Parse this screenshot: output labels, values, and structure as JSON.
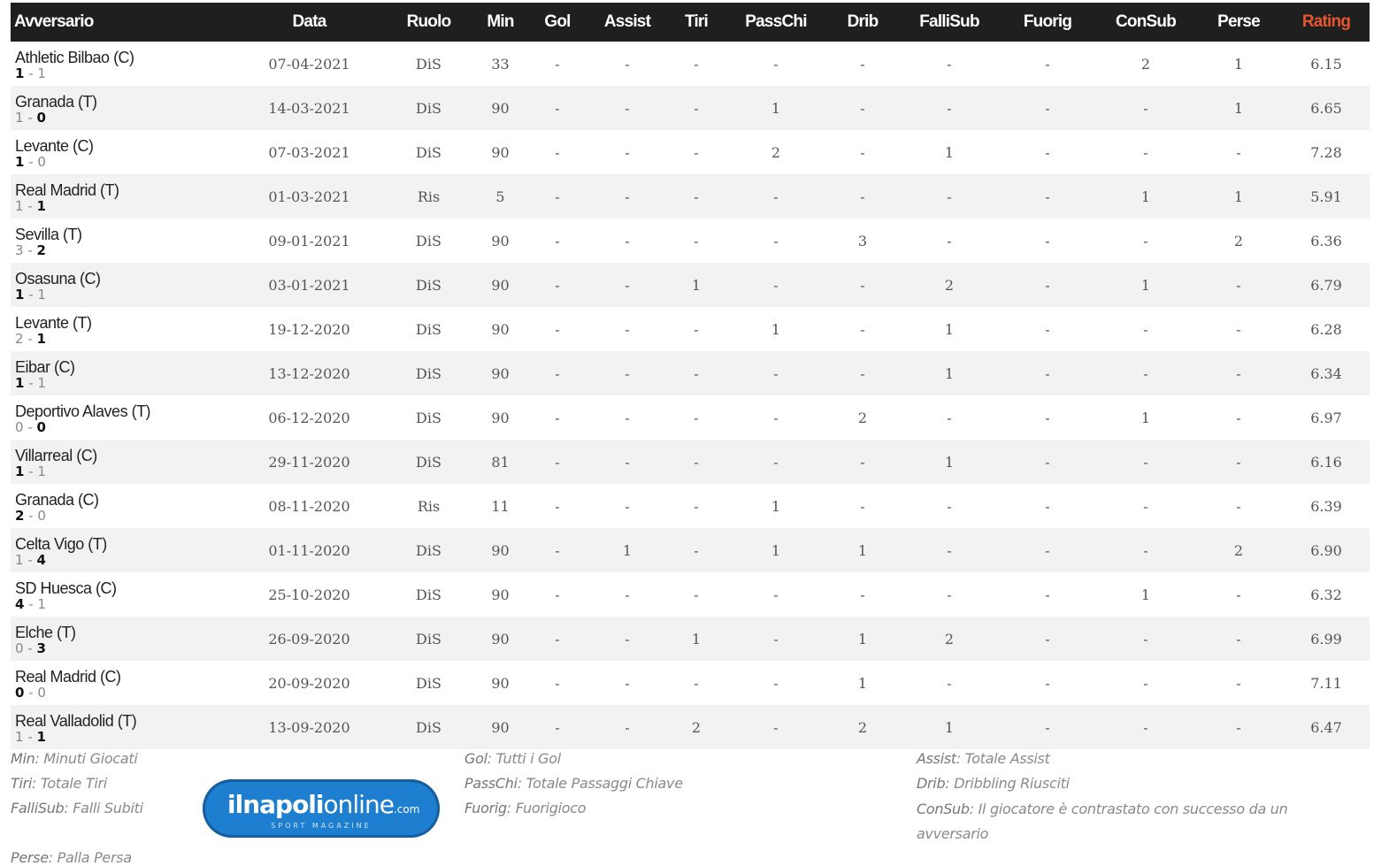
{
  "table": {
    "headers": [
      "Avversario",
      "Data",
      "Ruolo",
      "Min",
      "Gol",
      "Assist",
      "Tiri",
      "PassChi",
      "Drib",
      "FalliSub",
      "Fuorig",
      "ConSub",
      "Perse",
      "Rating"
    ],
    "rows": [
      {
        "opp": "Athletic Bilbao (C)",
        "s1": "1",
        "s2": "1",
        "bold": "left",
        "cells": [
          "07-04-2021",
          "DiS",
          "33",
          "-",
          "-",
          "-",
          "-",
          "-",
          "-",
          "-",
          "2",
          "1",
          "6.15"
        ]
      },
      {
        "opp": "Granada (T)",
        "s1": "1",
        "s2": "0",
        "bold": "right",
        "cells": [
          "14-03-2021",
          "DiS",
          "90",
          "-",
          "-",
          "-",
          "1",
          "-",
          "-",
          "-",
          "-",
          "1",
          "6.65"
        ]
      },
      {
        "opp": "Levante (C)",
        "s1": "1",
        "s2": "0",
        "bold": "left",
        "cells": [
          "07-03-2021",
          "DiS",
          "90",
          "-",
          "-",
          "-",
          "2",
          "-",
          "1",
          "-",
          "-",
          "-",
          "7.28"
        ]
      },
      {
        "opp": "Real Madrid (T)",
        "s1": "1",
        "s2": "1",
        "bold": "right",
        "cells": [
          "01-03-2021",
          "Ris",
          "5",
          "-",
          "-",
          "-",
          "-",
          "-",
          "-",
          "-",
          "1",
          "1",
          "5.91"
        ]
      },
      {
        "opp": "Sevilla (T)",
        "s1": "3",
        "s2": "2",
        "bold": "right",
        "cells": [
          "09-01-2021",
          "DiS",
          "90",
          "-",
          "-",
          "-",
          "-",
          "3",
          "-",
          "-",
          "-",
          "2",
          "6.36"
        ]
      },
      {
        "opp": "Osasuna (C)",
        "s1": "1",
        "s2": "1",
        "bold": "left",
        "cells": [
          "03-01-2021",
          "DiS",
          "90",
          "-",
          "-",
          "1",
          "-",
          "-",
          "2",
          "-",
          "1",
          "-",
          "6.79"
        ]
      },
      {
        "opp": "Levante (T)",
        "s1": "2",
        "s2": "1",
        "bold": "right",
        "cells": [
          "19-12-2020",
          "DiS",
          "90",
          "-",
          "-",
          "-",
          "1",
          "-",
          "1",
          "-",
          "-",
          "-",
          "6.28"
        ]
      },
      {
        "opp": "Eibar (C)",
        "s1": "1",
        "s2": "1",
        "bold": "left",
        "cells": [
          "13-12-2020",
          "DiS",
          "90",
          "-",
          "-",
          "-",
          "-",
          "-",
          "1",
          "-",
          "-",
          "-",
          "6.34"
        ]
      },
      {
        "opp": "Deportivo Alaves (T)",
        "s1": "0",
        "s2": "0",
        "bold": "right",
        "cells": [
          "06-12-2020",
          "DiS",
          "90",
          "-",
          "-",
          "-",
          "-",
          "2",
          "-",
          "-",
          "1",
          "-",
          "6.97"
        ]
      },
      {
        "opp": "Villarreal (C)",
        "s1": "1",
        "s2": "1",
        "bold": "left",
        "cells": [
          "29-11-2020",
          "DiS",
          "81",
          "-",
          "-",
          "-",
          "-",
          "-",
          "1",
          "-",
          "-",
          "-",
          "6.16"
        ]
      },
      {
        "opp": "Granada (C)",
        "s1": "2",
        "s2": "0",
        "bold": "left",
        "cells": [
          "08-11-2020",
          "Ris",
          "11",
          "-",
          "-",
          "-",
          "1",
          "-",
          "-",
          "-",
          "-",
          "-",
          "6.39"
        ]
      },
      {
        "opp": "Celta Vigo (T)",
        "s1": "1",
        "s2": "4",
        "bold": "right",
        "cells": [
          "01-11-2020",
          "DiS",
          "90",
          "-",
          "1",
          "-",
          "1",
          "1",
          "-",
          "-",
          "-",
          "2",
          "6.90"
        ]
      },
      {
        "opp": "SD Huesca (C)",
        "s1": "4",
        "s2": "1",
        "bold": "left",
        "cells": [
          "25-10-2020",
          "DiS",
          "90",
          "-",
          "-",
          "-",
          "-",
          "-",
          "-",
          "-",
          "1",
          "-",
          "6.32"
        ]
      },
      {
        "opp": "Elche (T)",
        "s1": "0",
        "s2": "3",
        "bold": "right",
        "cells": [
          "26-09-2020",
          "DiS",
          "90",
          "-",
          "-",
          "1",
          "-",
          "1",
          "2",
          "-",
          "-",
          "-",
          "6.99"
        ]
      },
      {
        "opp": "Real Madrid (C)",
        "s1": "0",
        "s2": "0",
        "bold": "left",
        "cells": [
          "20-09-2020",
          "DiS",
          "90",
          "-",
          "-",
          "-",
          "-",
          "1",
          "-",
          "-",
          "-",
          "-",
          "7.11"
        ]
      },
      {
        "opp": "Real Valladolid (T)",
        "s1": "1",
        "s2": "1",
        "bold": "right",
        "cells": [
          "13-09-2020",
          "DiS",
          "90",
          "-",
          "-",
          "2",
          "-",
          "2",
          "1",
          "-",
          "-",
          "-",
          "6.47"
        ]
      }
    ]
  },
  "legend": {
    "min_k": "Min",
    "min_v": ": Minuti Giocati",
    "tiri_k": "Tiri",
    "tiri_v": ": Totale Tiri",
    "fallisub_k": "FalliSub",
    "fallisub_v": ": Falli Subiti",
    "perse_k": "Perse",
    "perse_v": ": Palla Persa",
    "gol_k": "Gol",
    "gol_v": ": Tutti i Gol",
    "passchi_k": "PassChi",
    "passchi_v": ": Totale Passaggi Chiave",
    "fuorig_k": "Fuorig",
    "fuorig_v": ": Fuorigioco",
    "assist_k": "Assist",
    "assist_v": ": Totale Assist",
    "drib_k": "Drib",
    "drib_v": ": Dribbling Riusciti",
    "consub_k": "ConSub",
    "consub_v": ": Il giocatore è contrastato con successo da un avversario"
  },
  "logo": {
    "part1": "il",
    "part2": "napoli",
    "part3": "online",
    "part4": ".com",
    "sub": "SPORT MAGAZINE"
  },
  "colors": {
    "header_bg": "#1f1f1f",
    "rating": "#e4572e",
    "logo_bg": "#1e7fd0"
  }
}
